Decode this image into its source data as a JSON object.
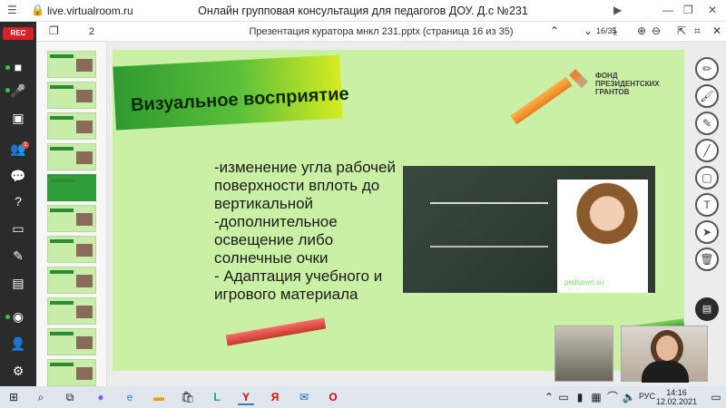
{
  "browser": {
    "url": "live.virtualroom.ru",
    "title": "Онлайн групповая консультация для педагогов ДОУ. Д.с №231"
  },
  "sidebar": {
    "rec_label": "REC",
    "items": [
      {
        "icon": "camera-icon"
      },
      {
        "icon": "microphone-icon"
      },
      {
        "icon": "presentation-icon"
      },
      {
        "icon": "users-icon"
      },
      {
        "icon": "chat-icon"
      },
      {
        "icon": "question-icon"
      },
      {
        "icon": "screen-share-icon"
      },
      {
        "icon": "pen-icon"
      },
      {
        "icon": "document-icon"
      },
      {
        "icon": "record-icon"
      },
      {
        "icon": "add-user-icon"
      },
      {
        "icon": "settings-icon"
      }
    ]
  },
  "doc_toolbar": {
    "pages_count": "2",
    "doc_title": "Презентация куратора мнкл 231.pptx (страница 16 из 35)",
    "page_indicator": "16/35"
  },
  "slide": {
    "heading": "Визуальное восприятие",
    "bullets": [
      "-изменение угла рабочей поверхности вплоть до вертикальной",
      "-дополнительное освещение либо солнечные очки",
      "- Адаптация учебного и игрового материала"
    ],
    "fund_name": "ФОНД ПРЕЗИДЕНТСКИХ ГРАНТОВ",
    "photo_caption": "pedsovet.su"
  },
  "right_tools": [
    "marker-icon",
    "brush-icon",
    "pencil-icon",
    "line-icon",
    "rectangle-icon",
    "text-icon",
    "pointer-icon",
    "trash-icon",
    "chat-icon"
  ],
  "taskbar": {
    "lang": "РУС",
    "time": "14:16",
    "date": "12.02.2021"
  },
  "colors": {
    "slide_bg": "#c9f0a4",
    "sidebar_bg": "#2b2b2b",
    "rec_red": "#d92028"
  }
}
